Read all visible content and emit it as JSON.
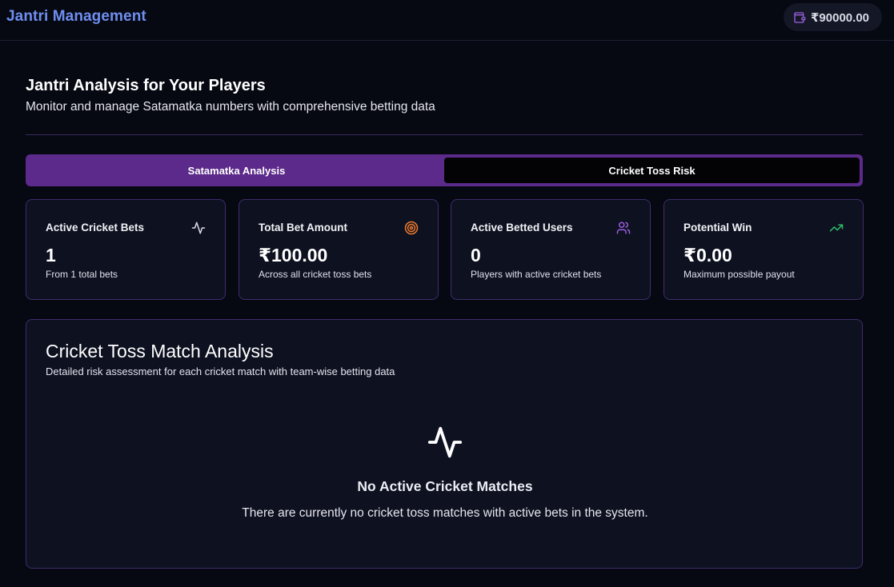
{
  "app": {
    "title": "Jantri Management",
    "wallet_balance": "₹90000.00"
  },
  "header": {
    "title": "Jantri Analysis for Your Players",
    "subtitle": "Monitor and manage Satamatka numbers with comprehensive betting data"
  },
  "tabs": [
    {
      "label": "Satamatka Analysis",
      "active": false
    },
    {
      "label": "Cricket Toss Risk",
      "active": true
    }
  ],
  "stats": [
    {
      "label": "Active Cricket Bets",
      "value": "1",
      "desc": "From 1 total bets",
      "icon": "activity-icon",
      "icon_color": "#d9dbe5"
    },
    {
      "label": "Total Bet Amount",
      "value": "₹100.00",
      "desc": "Across all cricket toss bets",
      "icon": "target-icon",
      "icon_color": "#f07a2c"
    },
    {
      "label": "Active Betted Users",
      "value": "0",
      "desc": "Players with active cricket bets",
      "icon": "users-icon",
      "icon_color": "#9b5fe0"
    },
    {
      "label": "Potential Win",
      "value": "₹0.00",
      "desc": "Maximum possible payout",
      "icon": "trending-up-icon",
      "icon_color": "#2fbf6a"
    }
  ],
  "analysis": {
    "title": "Cricket Toss Match Analysis",
    "subtitle": "Detailed risk assessment for each cricket match with team-wise betting data",
    "empty_icon": "activity-icon",
    "empty_title": "No Active Cricket Matches",
    "empty_desc": "There are currently no cricket toss matches with active bets in the system."
  },
  "colors": {
    "brand": "#6f8ff0",
    "tab_bar": "#5b2a8a",
    "card_border": "#3f2d6e",
    "background": "#060812"
  }
}
